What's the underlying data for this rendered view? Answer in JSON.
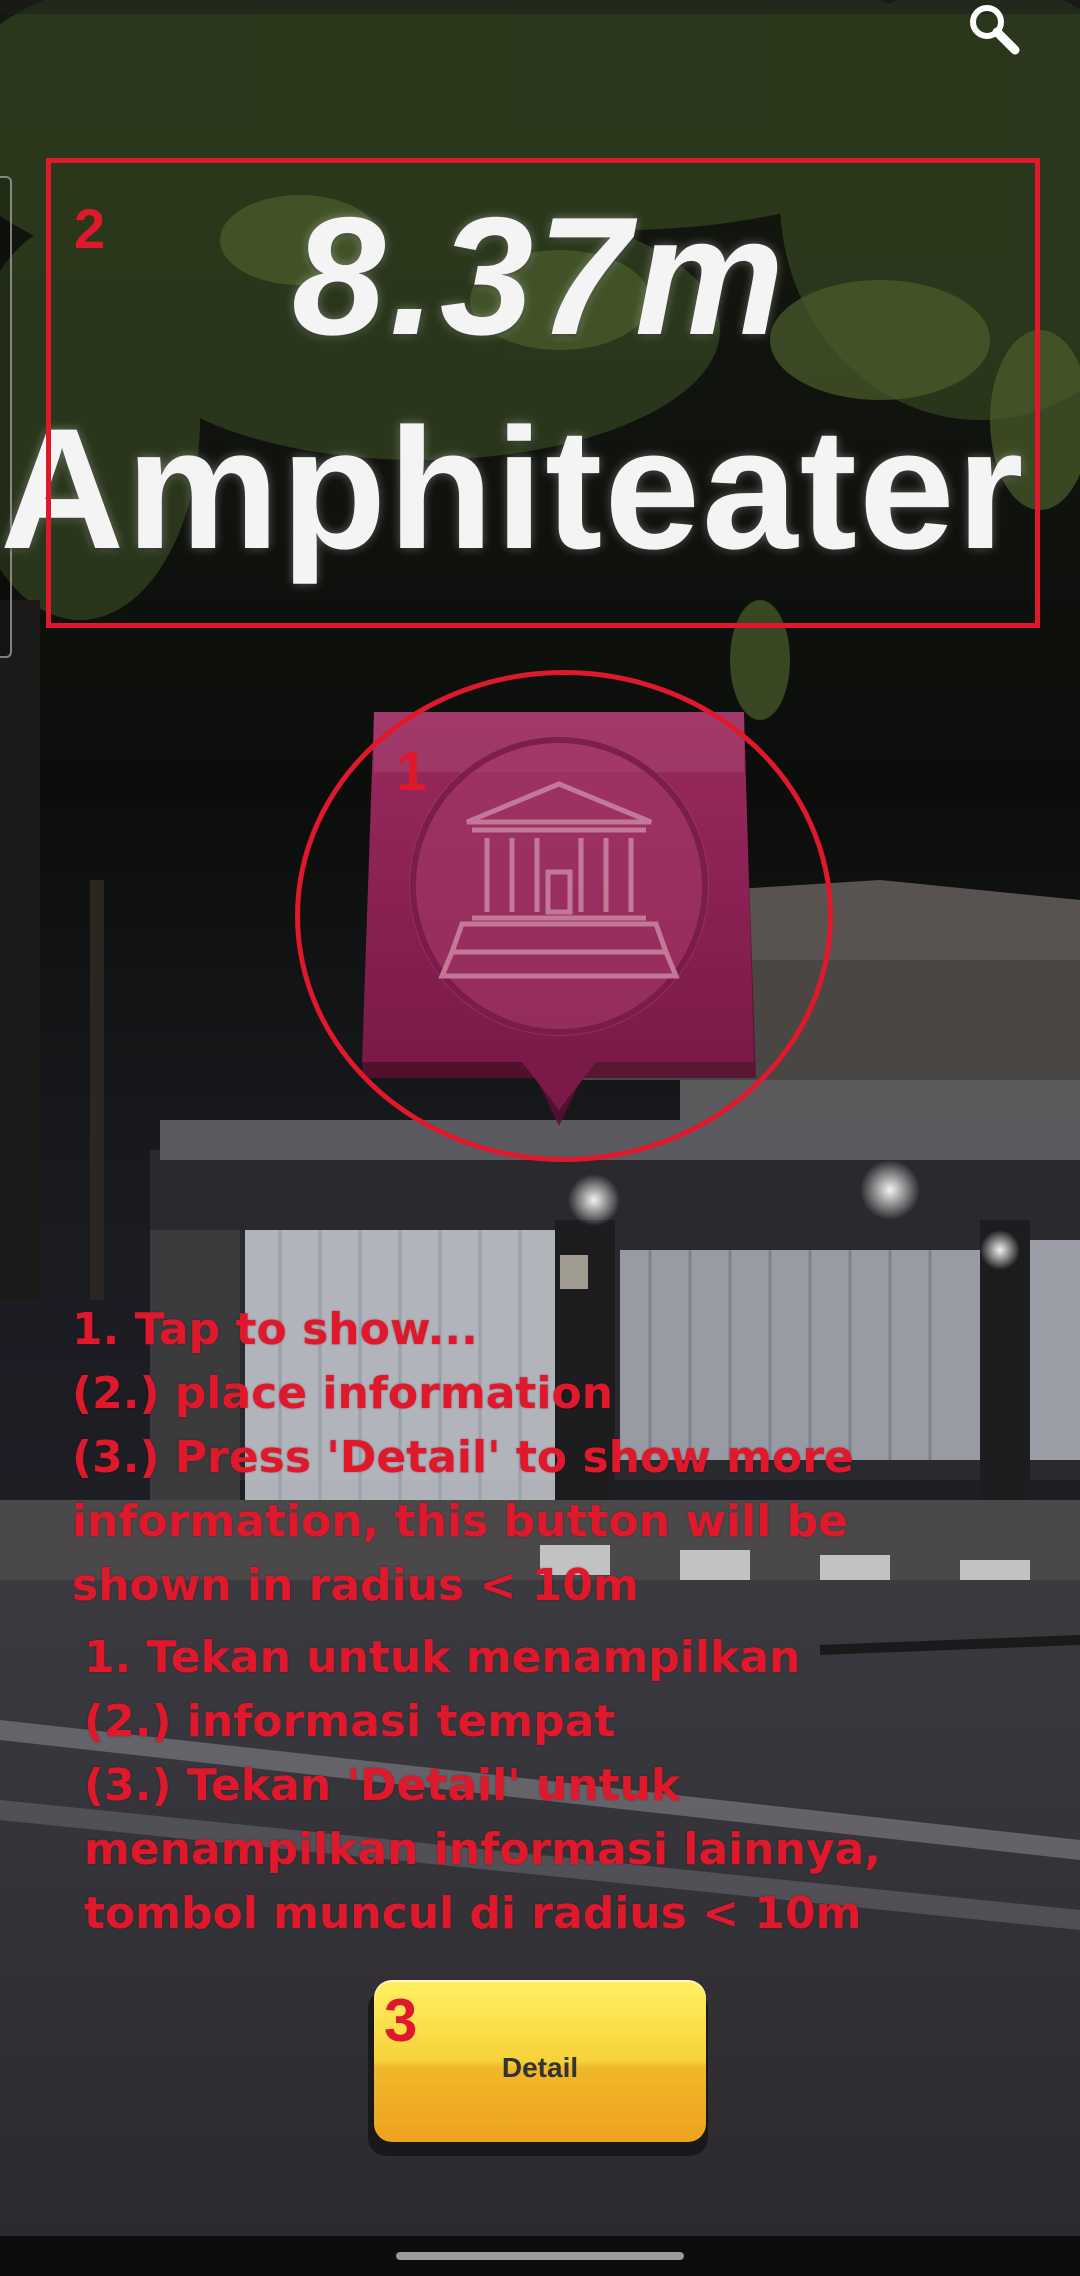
{
  "ar": {
    "distance": "8.37m",
    "place_name": "Amphiteater",
    "marker_icon": "amphitheater-building-icon",
    "marker_color": "#8c1f52"
  },
  "annotations": {
    "color": "#e0182c",
    "box_number": "2",
    "circle_number": "1",
    "button_number": "3"
  },
  "instructions": {
    "english": "1. Tap to show...\n(2.) place information\n(3.) Press 'Detail' to show more information, this button will be shown in radius < 10m",
    "indonesian": "1. Tekan untuk menampilkan\n(2.) informasi tempat\n(3.) Tekan 'Detail' untuk menampilkan informasi lainnya, tombol muncul di radius < 10m"
  },
  "toolbar": {
    "search_icon": "search-icon"
  },
  "detail_button": {
    "label": "Detail",
    "color": "#f7d23a"
  }
}
